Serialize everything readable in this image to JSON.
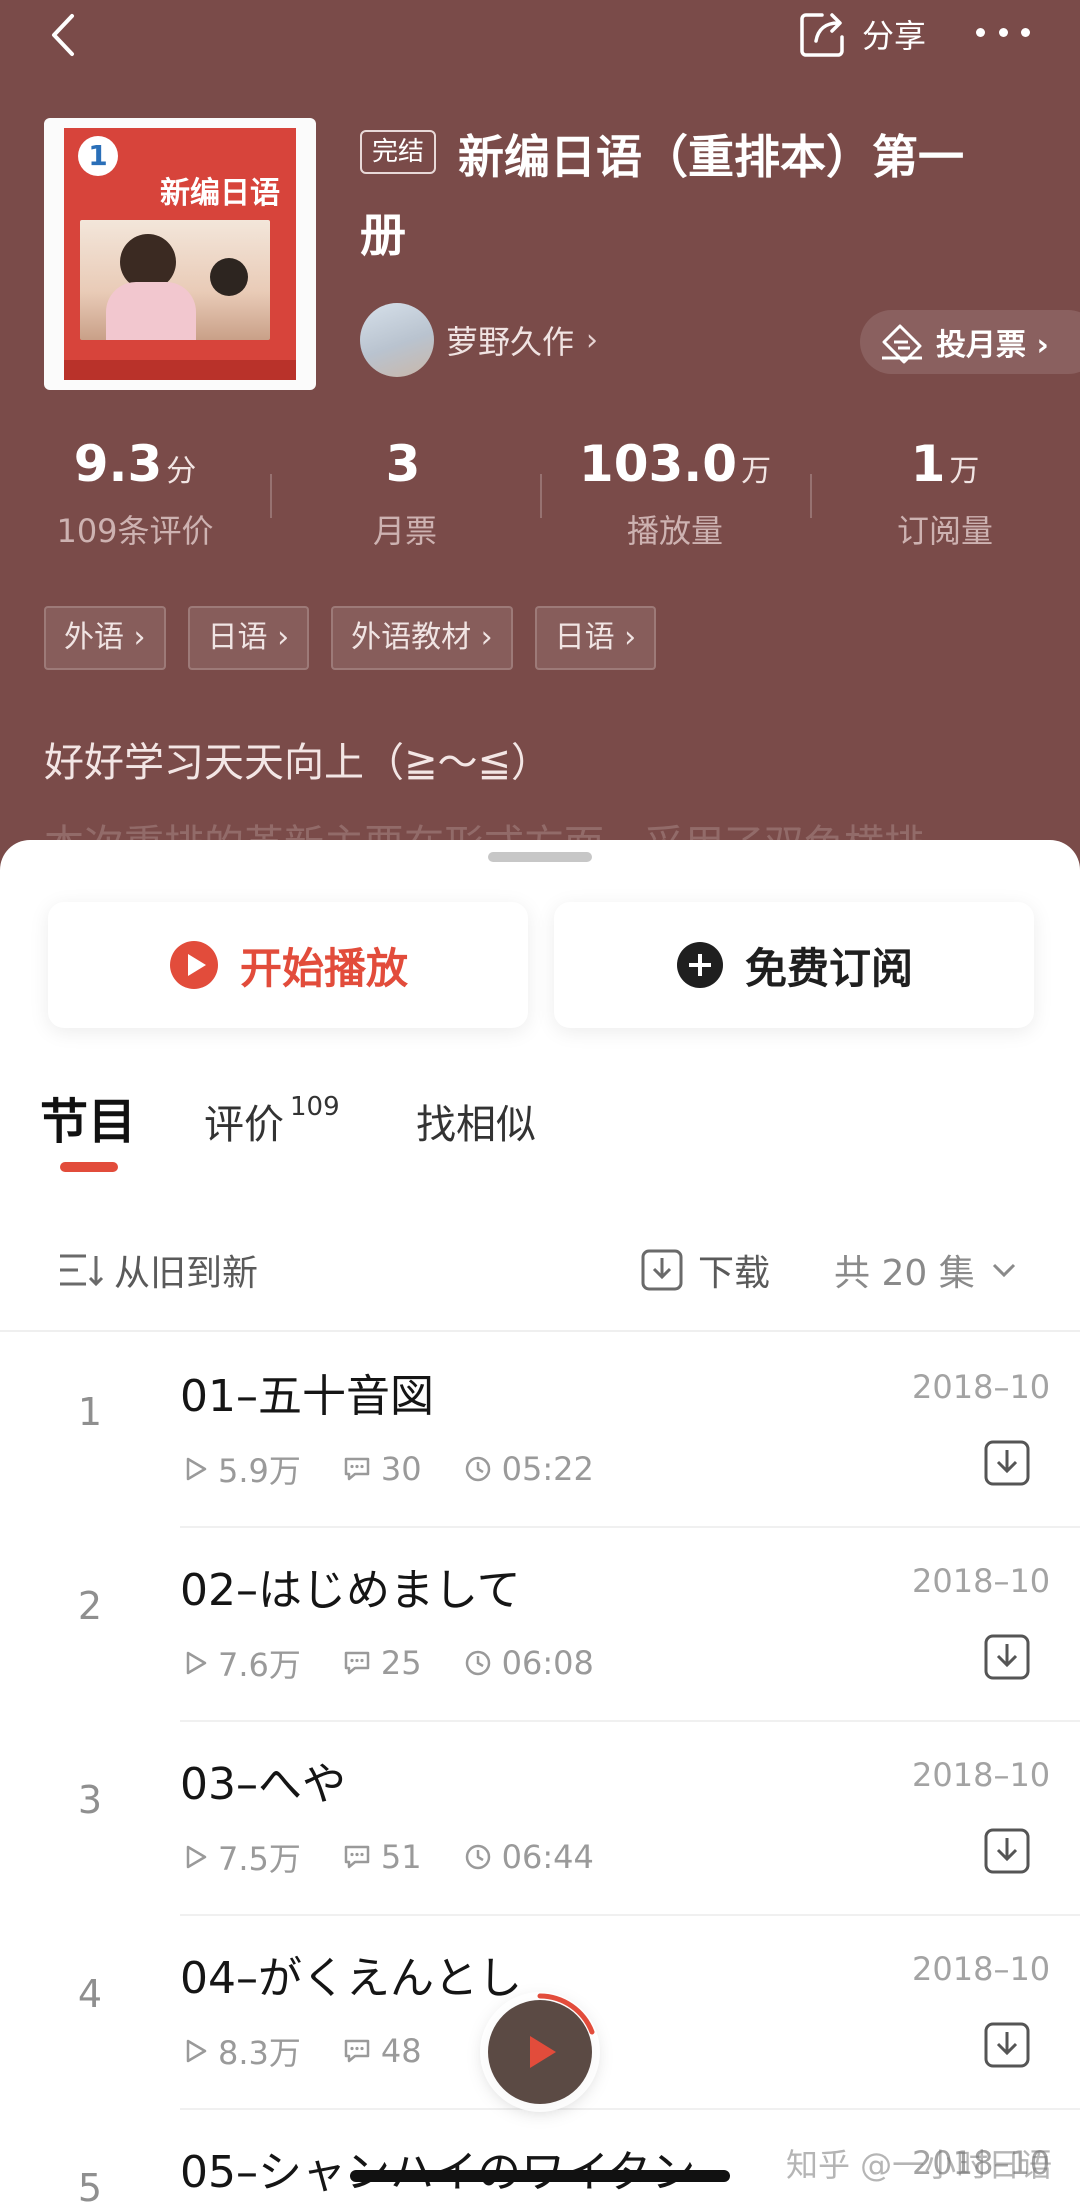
{
  "header": {
    "share_label": "分享",
    "finished_badge": "完结",
    "title_line1": "新编日语（重排本）第一",
    "title_line2": "册",
    "cover": {
      "volume_number": "1",
      "cover_title": "新编日语"
    },
    "author": {
      "name": "萝野久作",
      "chevron": "›"
    },
    "vote_label": "投月票 ›"
  },
  "stats": [
    {
      "value": "9.3",
      "unit": "分",
      "label": "109条评价"
    },
    {
      "value": "3",
      "unit": "",
      "label": "月票"
    },
    {
      "value": "103.0",
      "unit": "万",
      "label": "播放量"
    },
    {
      "value": "1",
      "unit": "万",
      "label": "订阅量"
    }
  ],
  "tags": [
    "外语 ›",
    "日语 ›",
    "外语教材 ›",
    "日语 ›"
  ],
  "slogan": "好好学习天天向上（≧～≦）",
  "description_preview": "本次重排的革新主要在形式方面，采用了双色横排",
  "actions": {
    "play_label": "开始播放",
    "subscribe_label": "免费订阅"
  },
  "tabs": {
    "programs": "节目",
    "reviews": "评价",
    "reviews_count": "109",
    "similar": "找相似"
  },
  "sortbar": {
    "sort_label": "从旧到新",
    "download_label": "下载",
    "count_label": "共 20 集"
  },
  "episodes": [
    {
      "index": "1",
      "title": "01–五十音図",
      "date": "2018–10",
      "plays": "5.9万",
      "comments": "30",
      "duration": "05:22"
    },
    {
      "index": "2",
      "title": "02–はじめまして",
      "date": "2018–10",
      "plays": "7.6万",
      "comments": "25",
      "duration": "06:08"
    },
    {
      "index": "3",
      "title": "03–へや",
      "date": "2018–10",
      "plays": "7.5万",
      "comments": "51",
      "duration": "06:44"
    },
    {
      "index": "4",
      "title": "04–がくえんとし",
      "date": "2018–10",
      "plays": "8.3万",
      "comments": "48",
      "duration": ""
    },
    {
      "index": "5",
      "title": "05–シャンハイのワイタン",
      "date": "2018–10",
      "plays": "",
      "comments": "",
      "duration": ""
    }
  ],
  "watermark": "知乎 @一小时日语",
  "colors": {
    "hero_bg": "#7a4b49",
    "accent": "#e24c3b"
  }
}
